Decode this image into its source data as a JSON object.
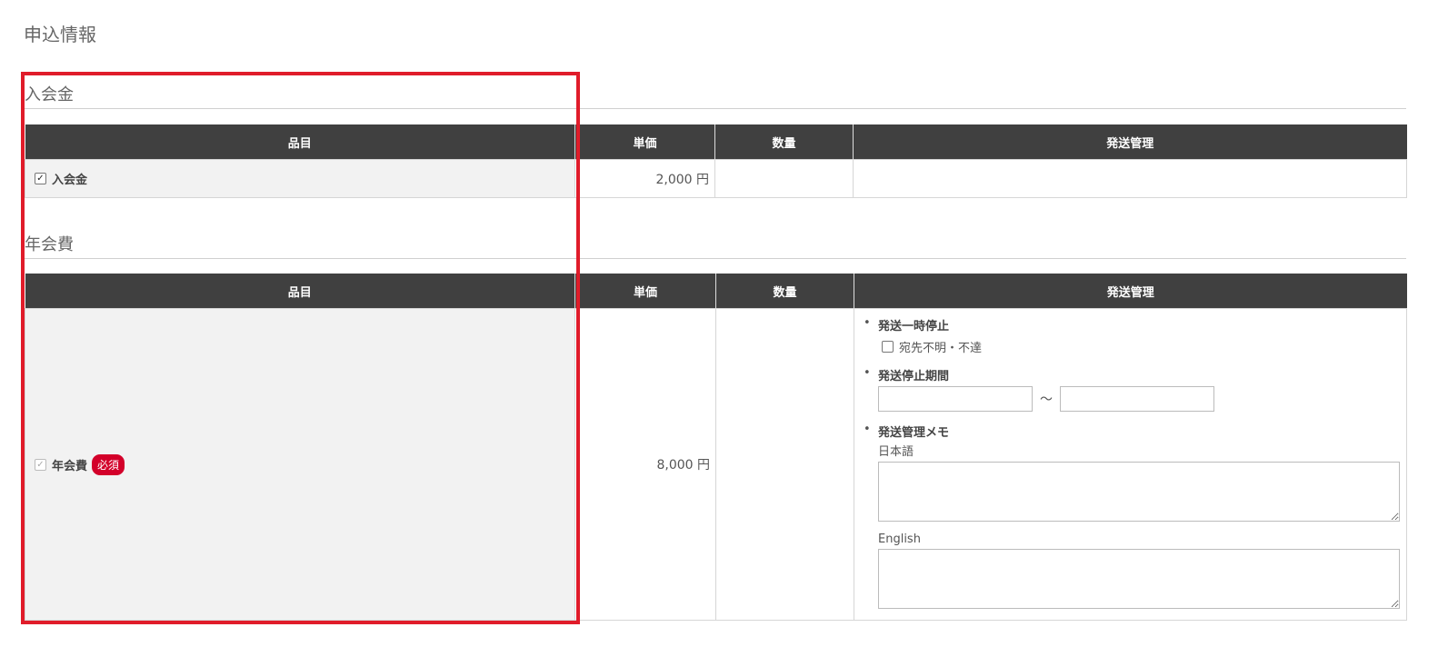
{
  "page": {
    "title": "申込情報"
  },
  "headers": {
    "item": "品目",
    "unit_price": "単価",
    "quantity": "数量",
    "shipping": "発送管理"
  },
  "sections": [
    {
      "title": "入会金",
      "row": {
        "name": "入会金",
        "checked": true,
        "price": "2,000 円",
        "quantity": ""
      }
    },
    {
      "title": "年会費",
      "row": {
        "name": "年会費",
        "checked": true,
        "disabled": true,
        "badge": "必須",
        "price": "8,000 円",
        "quantity": ""
      }
    }
  ],
  "shipping": {
    "pause_label": "発送一時停止",
    "unknown_address_label": "宛先不明・不達",
    "unknown_address_checked": false,
    "stop_period_label": "発送停止期間",
    "range_separator": "〜",
    "memo_label": "発送管理メモ",
    "lang_ja": "日本語",
    "lang_en": "English",
    "bullet": "•"
  },
  "colors": {
    "header_bg": "#404040",
    "item_cell_bg": "#f2f2f2",
    "badge_red": "#d3002a",
    "highlight": "#e01c2a"
  }
}
